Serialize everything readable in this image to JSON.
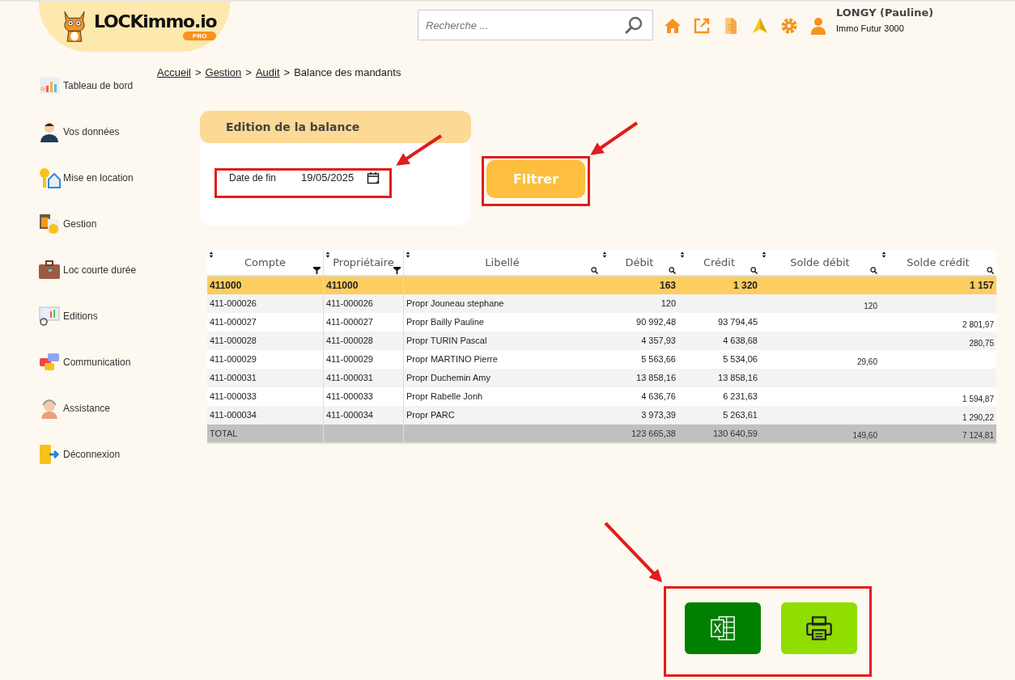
{
  "logo": {
    "name": "LOCKimmo.io",
    "badge": "PRO"
  },
  "search": {
    "placeholder": "Recherche ..."
  },
  "user": {
    "name": "LONGY (Pauline)",
    "agency": "Immo Futur 3000"
  },
  "sidebar": {
    "items": [
      {
        "label": "Tableau de bord",
        "kind": "dashboard"
      },
      {
        "label": "Vos données",
        "kind": "person"
      },
      {
        "label": "Mise en location",
        "kind": "key"
      },
      {
        "label": "Gestion",
        "kind": "calculator"
      },
      {
        "label": "Loc courte durée",
        "kind": "suitcase"
      },
      {
        "label": "Editions",
        "kind": "monitor"
      },
      {
        "label": "Communication",
        "kind": "chat"
      },
      {
        "label": "Assistance",
        "kind": "headset"
      },
      {
        "label": "Déconnexion",
        "kind": "exit"
      }
    ]
  },
  "breadcrumb": [
    {
      "kind": "link",
      "text": "Accueil"
    },
    {
      "kind": "separator",
      "text": ">"
    },
    {
      "kind": "link",
      "text": "Gestion"
    },
    {
      "kind": "separator",
      "text": ">"
    },
    {
      "kind": "link",
      "text": "Audit"
    },
    {
      "kind": "separator",
      "text": ">"
    },
    {
      "kind": "current",
      "text": "Balance des mandants"
    }
  ],
  "filter_card": {
    "title": "Edition de la balance",
    "date_label": "Date de fin",
    "date_value": "19/05/2025",
    "button": "Filtrer"
  },
  "table": {
    "columns": [
      {
        "label": "Compte",
        "kind": "filter"
      },
      {
        "label": "Propriétaire",
        "kind": "filter"
      },
      {
        "label": "Libellé",
        "kind": "search"
      },
      {
        "label": "Débit",
        "kind": "search"
      },
      {
        "label": "Crédit",
        "kind": "search"
      },
      {
        "label": "Solde débit",
        "kind": "search"
      },
      {
        "label": "Solde crédit",
        "kind": "search"
      }
    ],
    "rows": [
      {
        "kind": "group",
        "cells": [
          "411000",
          "411000",
          null,
          "163",
          "1 320",
          null,
          "1 157"
        ]
      },
      {
        "kind": "detail",
        "cells": [
          "411-000026",
          "411-000026",
          "Propr Jouneau stephane",
          "120",
          null,
          "120",
          null
        ]
      },
      {
        "kind": "detail",
        "cells": [
          "411-000027",
          "411-000027",
          "Propr Bailly Pauline",
          "90 992,48",
          "93 794,45",
          null,
          "2 801,97"
        ]
      },
      {
        "kind": "detail",
        "cells": [
          "411-000028",
          "411-000028",
          "Propr TURIN Pascal",
          "4 357,93",
          "4 638,68",
          null,
          "280,75"
        ]
      },
      {
        "kind": "detail",
        "cells": [
          "411-000029",
          "411-000029",
          "Propr MARTINO Pierre",
          "5 563,66",
          "5 534,06",
          "29,60",
          null
        ]
      },
      {
        "kind": "detail",
        "cells": [
          "411-000031",
          "411-000031",
          "Propr Duchemin Amy",
          "13 858,16",
          "13 858,16",
          null,
          null
        ]
      },
      {
        "kind": "detail",
        "cells": [
          "411-000033",
          "411-000033",
          "Propr Rabelle Jonh",
          "4 636,76",
          "6 231,63",
          null,
          "1 594,87"
        ]
      },
      {
        "kind": "detail",
        "cells": [
          "411-000034",
          "411-000034",
          "Propr PARC",
          "3 973,39",
          "5 263,61",
          null,
          "1 290,22"
        ]
      },
      {
        "kind": "total",
        "cells": [
          "TOTAL",
          null,
          null,
          "123 665,38",
          "130 640,59",
          "149,60",
          "7 124,81"
        ]
      }
    ]
  },
  "exports": [
    {
      "kind": "excel"
    },
    {
      "kind": "print"
    }
  ]
}
